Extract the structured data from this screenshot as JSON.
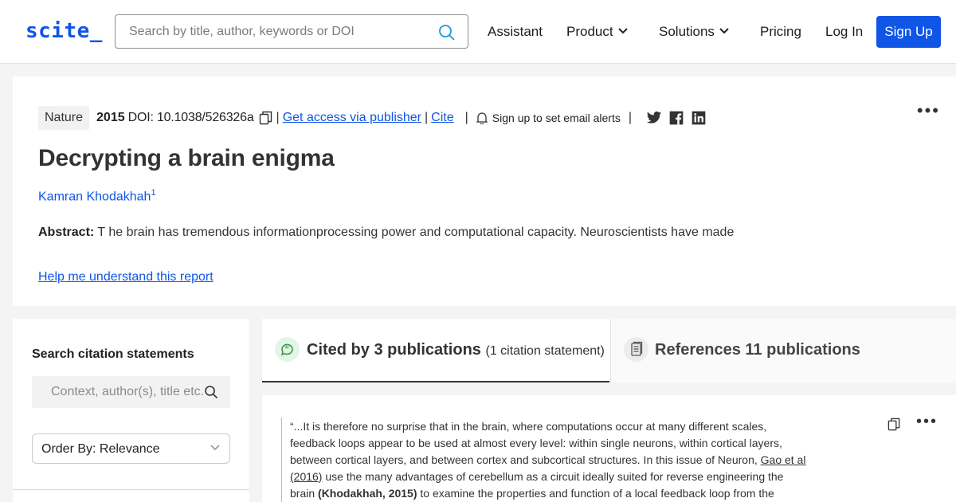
{
  "nav": {
    "logo": "scite_",
    "search_placeholder": "Search by title, author, keywords or DOI",
    "links": {
      "assistant": "Assistant",
      "product": "Product",
      "solutions": "Solutions",
      "pricing": "Pricing",
      "login": "Log In"
    },
    "signup": "Sign Up"
  },
  "paper": {
    "journal": "Nature",
    "year": "2015",
    "doi": "DOI: 10.1038/526326a",
    "get_access": "Get access via publisher",
    "cite": "Cite",
    "alert": "Sign up to set email alerts",
    "title": "Decrypting a brain enigma",
    "author": "Kamran Khodakhah",
    "author_sup": "1",
    "abstract_label": "Abstract:",
    "abstract_text": " T he brain has tremendous informationprocessing power and computational capacity. Neuroscientists have made",
    "help_link": "Help me understand this report"
  },
  "sidebar": {
    "heading": "Search citation statements",
    "search_placeholder": "Context, author(s), title etc.",
    "order_by": "Order By: Relevance"
  },
  "tabs": {
    "cited_by": "Cited by 3 publications",
    "cited_by_sub": "(1 citation statement)",
    "references": "References 11 publications"
  },
  "citation": {
    "part1": "“...It is therefore no surprise that in the brain, where computations occur at many different scales, feedback loops appear to be used at almost every level: within single neurons, within cortical layers, between cortical layers, and between cortex and subcortical structures. In this issue of Neuron, ",
    "ref_link": "Gao et al (2016)",
    "part2": " use the many advantages of cerebellum as a circuit ideally suited for reverse engineering the brain ",
    "self_ref": "(Khodakhah, 2015)",
    "part3": " to examine the properties and function of a local feedback loop from the"
  },
  "colors": {
    "brand": "#0f56e6",
    "cited_icon": "#3a9a47"
  },
  "icons": [
    "search-icon",
    "copy-icon",
    "bell-icon",
    "twitter-icon",
    "facebook-icon",
    "linkedin-icon",
    "more-icon",
    "chevron-down-icon",
    "cited-icon",
    "references-icon"
  ]
}
